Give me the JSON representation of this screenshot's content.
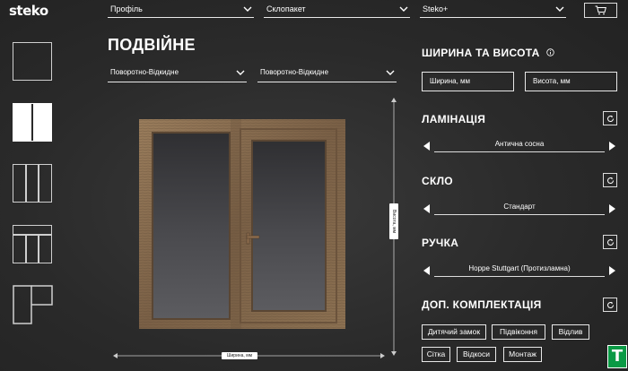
{
  "header": {
    "logo": "steko",
    "selects": [
      {
        "value": "Профіль"
      },
      {
        "value": "Склопакет"
      },
      {
        "value": "Steko+"
      }
    ],
    "cart_icon": "cart-icon"
  },
  "window_types": [
    {
      "name": "single",
      "active": false
    },
    {
      "name": "double",
      "active": true
    },
    {
      "name": "triple",
      "active": false
    },
    {
      "name": "triple-transom",
      "active": false
    },
    {
      "name": "balcony-block",
      "active": false
    }
  ],
  "main": {
    "title": "ПОДВІЙНЕ",
    "opening_selects": [
      {
        "value": "Поворотно-Відкидне"
      },
      {
        "value": "Поворотно-Відкидне"
      }
    ],
    "dim_height_label": "Висота, мм",
    "dim_width_label": "Ширина, мм"
  },
  "panel": {
    "size_title": "ШИРИНА ТА ВИСОТА",
    "info_icon": "info-icon",
    "width_placeholder": "Ширина, мм",
    "height_placeholder": "Висота, мм",
    "lamination_title": "ЛАМІНАЦІЯ",
    "lamination_value": "Антична сосна",
    "glass_title": "СКЛО",
    "glass_value": "Стандарт",
    "handle_title": "РУЧКА",
    "handle_value": "Hoppe Stuttgart (Протизламна)",
    "extras_title": "ДОП. КОМПЛЕКТАЦІЯ",
    "extras": [
      "Дитячий замок",
      "Підвіконня",
      "Відлив",
      "Сітка",
      "Відкоси",
      "Монтаж"
    ]
  },
  "badge": "T",
  "colors": {
    "background": "#2a2a2a",
    "foreground": "#ffffff",
    "badge_green": "#0a9a45",
    "wood": "#8a6d4e"
  }
}
